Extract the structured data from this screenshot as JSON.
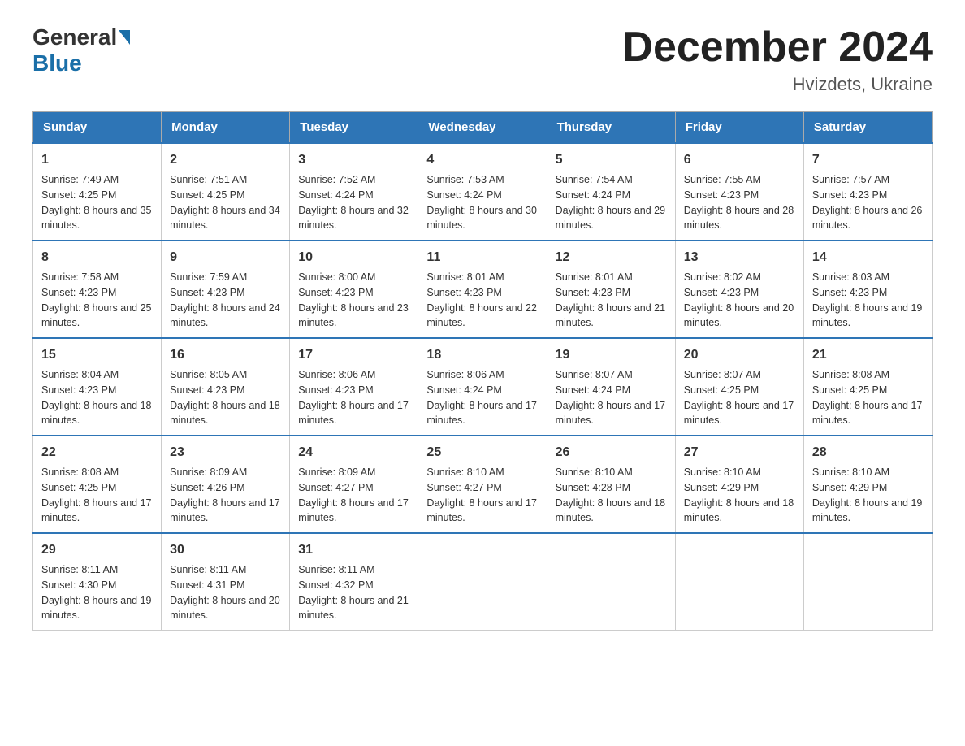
{
  "header": {
    "logo_general": "General",
    "logo_blue": "Blue",
    "month_title": "December 2024",
    "location": "Hvizdets, Ukraine"
  },
  "days_of_week": [
    "Sunday",
    "Monday",
    "Tuesday",
    "Wednesday",
    "Thursday",
    "Friday",
    "Saturday"
  ],
  "weeks": [
    [
      {
        "day": "1",
        "sunrise": "7:49 AM",
        "sunset": "4:25 PM",
        "daylight": "8 hours and 35 minutes."
      },
      {
        "day": "2",
        "sunrise": "7:51 AM",
        "sunset": "4:25 PM",
        "daylight": "8 hours and 34 minutes."
      },
      {
        "day": "3",
        "sunrise": "7:52 AM",
        "sunset": "4:24 PM",
        "daylight": "8 hours and 32 minutes."
      },
      {
        "day": "4",
        "sunrise": "7:53 AM",
        "sunset": "4:24 PM",
        "daylight": "8 hours and 30 minutes."
      },
      {
        "day": "5",
        "sunrise": "7:54 AM",
        "sunset": "4:24 PM",
        "daylight": "8 hours and 29 minutes."
      },
      {
        "day": "6",
        "sunrise": "7:55 AM",
        "sunset": "4:23 PM",
        "daylight": "8 hours and 28 minutes."
      },
      {
        "day": "7",
        "sunrise": "7:57 AM",
        "sunset": "4:23 PM",
        "daylight": "8 hours and 26 minutes."
      }
    ],
    [
      {
        "day": "8",
        "sunrise": "7:58 AM",
        "sunset": "4:23 PM",
        "daylight": "8 hours and 25 minutes."
      },
      {
        "day": "9",
        "sunrise": "7:59 AM",
        "sunset": "4:23 PM",
        "daylight": "8 hours and 24 minutes."
      },
      {
        "day": "10",
        "sunrise": "8:00 AM",
        "sunset": "4:23 PM",
        "daylight": "8 hours and 23 minutes."
      },
      {
        "day": "11",
        "sunrise": "8:01 AM",
        "sunset": "4:23 PM",
        "daylight": "8 hours and 22 minutes."
      },
      {
        "day": "12",
        "sunrise": "8:01 AM",
        "sunset": "4:23 PM",
        "daylight": "8 hours and 21 minutes."
      },
      {
        "day": "13",
        "sunrise": "8:02 AM",
        "sunset": "4:23 PM",
        "daylight": "8 hours and 20 minutes."
      },
      {
        "day": "14",
        "sunrise": "8:03 AM",
        "sunset": "4:23 PM",
        "daylight": "8 hours and 19 minutes."
      }
    ],
    [
      {
        "day": "15",
        "sunrise": "8:04 AM",
        "sunset": "4:23 PM",
        "daylight": "8 hours and 18 minutes."
      },
      {
        "day": "16",
        "sunrise": "8:05 AM",
        "sunset": "4:23 PM",
        "daylight": "8 hours and 18 minutes."
      },
      {
        "day": "17",
        "sunrise": "8:06 AM",
        "sunset": "4:23 PM",
        "daylight": "8 hours and 17 minutes."
      },
      {
        "day": "18",
        "sunrise": "8:06 AM",
        "sunset": "4:24 PM",
        "daylight": "8 hours and 17 minutes."
      },
      {
        "day": "19",
        "sunrise": "8:07 AM",
        "sunset": "4:24 PM",
        "daylight": "8 hours and 17 minutes."
      },
      {
        "day": "20",
        "sunrise": "8:07 AM",
        "sunset": "4:25 PM",
        "daylight": "8 hours and 17 minutes."
      },
      {
        "day": "21",
        "sunrise": "8:08 AM",
        "sunset": "4:25 PM",
        "daylight": "8 hours and 17 minutes."
      }
    ],
    [
      {
        "day": "22",
        "sunrise": "8:08 AM",
        "sunset": "4:25 PM",
        "daylight": "8 hours and 17 minutes."
      },
      {
        "day": "23",
        "sunrise": "8:09 AM",
        "sunset": "4:26 PM",
        "daylight": "8 hours and 17 minutes."
      },
      {
        "day": "24",
        "sunrise": "8:09 AM",
        "sunset": "4:27 PM",
        "daylight": "8 hours and 17 minutes."
      },
      {
        "day": "25",
        "sunrise": "8:10 AM",
        "sunset": "4:27 PM",
        "daylight": "8 hours and 17 minutes."
      },
      {
        "day": "26",
        "sunrise": "8:10 AM",
        "sunset": "4:28 PM",
        "daylight": "8 hours and 18 minutes."
      },
      {
        "day": "27",
        "sunrise": "8:10 AM",
        "sunset": "4:29 PM",
        "daylight": "8 hours and 18 minutes."
      },
      {
        "day": "28",
        "sunrise": "8:10 AM",
        "sunset": "4:29 PM",
        "daylight": "8 hours and 19 minutes."
      }
    ],
    [
      {
        "day": "29",
        "sunrise": "8:11 AM",
        "sunset": "4:30 PM",
        "daylight": "8 hours and 19 minutes."
      },
      {
        "day": "30",
        "sunrise": "8:11 AM",
        "sunset": "4:31 PM",
        "daylight": "8 hours and 20 minutes."
      },
      {
        "day": "31",
        "sunrise": "8:11 AM",
        "sunset": "4:32 PM",
        "daylight": "8 hours and 21 minutes."
      },
      null,
      null,
      null,
      null
    ]
  ],
  "labels": {
    "sunrise": "Sunrise:",
    "sunset": "Sunset:",
    "daylight": "Daylight:"
  }
}
